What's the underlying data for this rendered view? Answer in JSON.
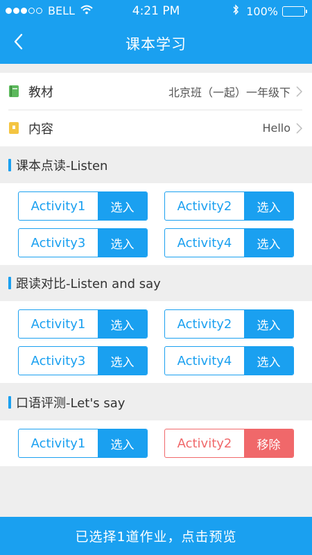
{
  "status_bar": {
    "carrier": "BELL",
    "time": "4:21 PM",
    "battery": "100%"
  },
  "nav": {
    "title": "课本学习"
  },
  "info": {
    "textbook": {
      "label": "教材",
      "value": "北京班（一起）一年级下"
    },
    "content": {
      "label": "内容",
      "value": "Hello"
    }
  },
  "sections": [
    {
      "title": "课本点读-Listen",
      "activities": [
        {
          "name": "Activity1",
          "action": "选入"
        },
        {
          "name": "Activity2",
          "action": "选入"
        },
        {
          "name": "Activity3",
          "action": "选入"
        },
        {
          "name": "Activity4",
          "action": "选入"
        }
      ]
    },
    {
      "title": "跟读对比-Listen and say",
      "activities": [
        {
          "name": "Activity1",
          "action": "选入"
        },
        {
          "name": "Activity2",
          "action": "选入"
        },
        {
          "name": "Activity3",
          "action": "选入"
        },
        {
          "name": "Activity4",
          "action": "选入"
        }
      ]
    },
    {
      "title": "口语评测-Let's  say",
      "activities": [
        {
          "name": "Activity1",
          "action": "选入"
        },
        {
          "name": "Activity2",
          "action": "移除"
        }
      ]
    }
  ],
  "footer": {
    "label": "已选择1道作业，点击预览"
  },
  "colors": {
    "primary": "#1aa0f0",
    "remove": "#f0686a",
    "background": "#eeeeee"
  },
  "icons": {
    "textbook": "green-book-icon",
    "content": "yellow-notebook-icon",
    "back": "chevron-left-icon",
    "row_arrow": "chevron-right-icon"
  }
}
